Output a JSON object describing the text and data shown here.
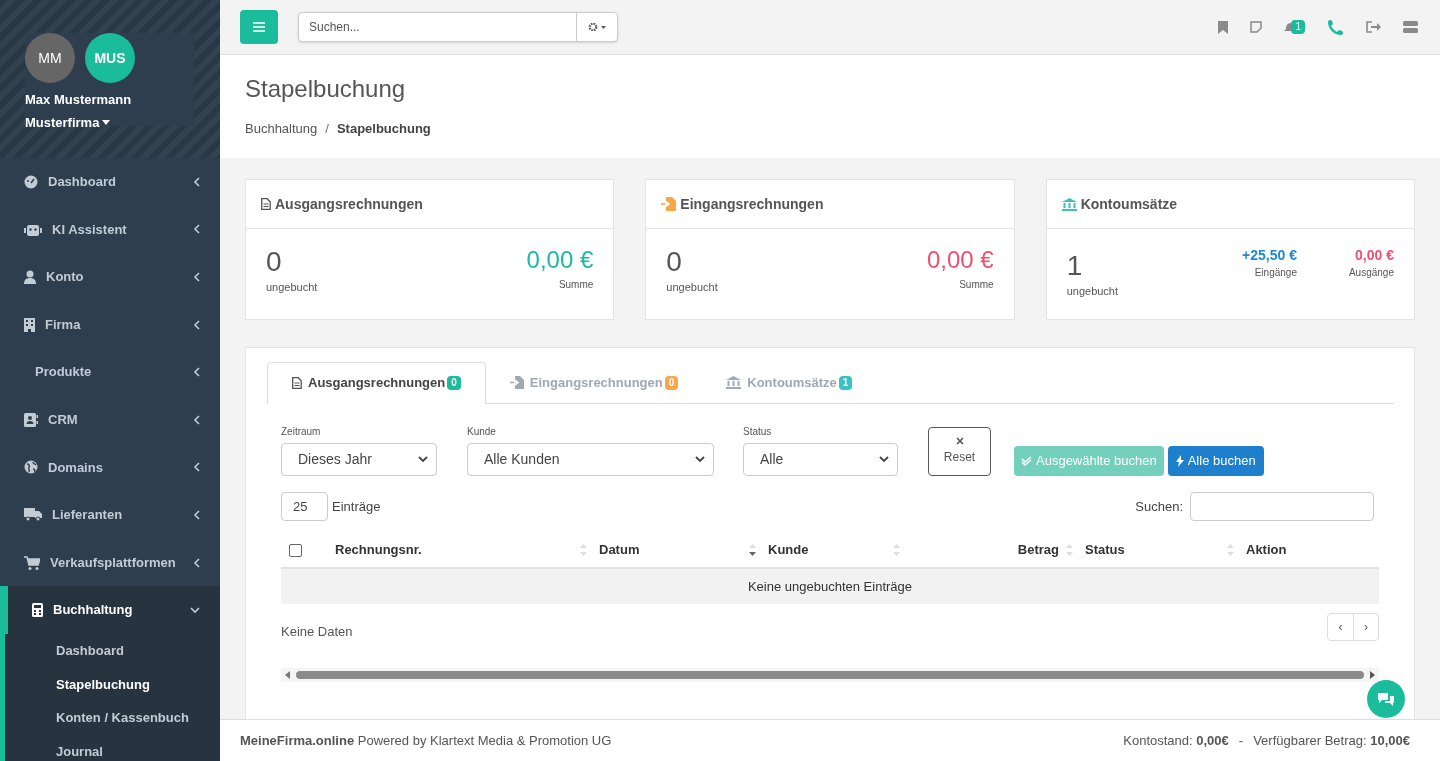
{
  "profile": {
    "avatars": [
      "MM",
      "MUS"
    ],
    "name": "Max Mustermann",
    "company": "Musterfirma"
  },
  "sidebar": {
    "items": [
      {
        "label": "Dashboard",
        "expanded": false,
        "selected": false
      },
      {
        "label": "KI Assistent",
        "expanded": false,
        "selected": false
      },
      {
        "label": "Konto",
        "expanded": false,
        "selected": false
      },
      {
        "label": "Firma",
        "expanded": false,
        "selected": false
      },
      {
        "label": "Produkte",
        "expanded": false,
        "selected": false
      },
      {
        "label": "CRM",
        "expanded": false,
        "selected": false
      },
      {
        "label": "Domains",
        "expanded": false,
        "selected": false
      },
      {
        "label": "Lieferanten",
        "expanded": false,
        "selected": false
      },
      {
        "label": "Verkaufsplattformen",
        "expanded": false,
        "selected": false
      },
      {
        "label": "Buchhaltung",
        "expanded": true,
        "selected": true,
        "children": [
          {
            "label": "Dashboard",
            "selected": false
          },
          {
            "label": "Stapelbuchung",
            "selected": true
          },
          {
            "label": "Konten / Kassenbuch",
            "selected": false
          },
          {
            "label": "Journal",
            "selected": false
          }
        ]
      }
    ]
  },
  "topbar": {
    "search": {
      "placeholder": "Suchen..."
    },
    "notification_count": "1"
  },
  "page": {
    "title": "Stapelbuchung",
    "breadcrumb": [
      "Buchhaltung",
      "Stapelbuchung"
    ],
    "breadcrumb_separator": "/"
  },
  "cards": [
    {
      "title": "Ausgangsrechnungen",
      "count": "0",
      "count_label": "ungebucht",
      "amounts": [
        {
          "value": "0,00 €",
          "label": "Summe",
          "color": "#1abc9c"
        }
      ]
    },
    {
      "title": "Eingangsrechnungen",
      "count": "0",
      "count_label": "ungebucht",
      "amounts": [
        {
          "value": "0,00 €",
          "label": "Summe",
          "color": "#f0506e"
        }
      ]
    },
    {
      "title": "Kontoumsätze",
      "count": "1",
      "count_label": "ungebucht",
      "amounts": [
        {
          "value": "+25,50 €",
          "label": "Eingänge",
          "color": "#1e88d0"
        },
        {
          "value": "0,00 €",
          "label": "Ausgänge",
          "color": "#f0506e"
        }
      ]
    }
  ],
  "tabs": [
    {
      "label": "Ausgangsrechnungen",
      "count": "0",
      "color": "#1abc9c",
      "selected": true
    },
    {
      "label": "Eingangsrechnungen",
      "count": "0",
      "color": "#f7a64a",
      "selected": false
    },
    {
      "label": "Kontoumsätze",
      "count": "1",
      "color": "#3bc0c3",
      "selected": false
    }
  ],
  "filters": [
    {
      "label": "Zeitraum",
      "value": "Dieses Jahr"
    },
    {
      "label": "Kunde",
      "value": "Alle Kunden"
    },
    {
      "label": "Status",
      "value": "Alle"
    }
  ],
  "buttons": {
    "reset": "Reset",
    "book_selected": {
      "label": "Ausgewählte buchen",
      "disabled": true
    },
    "book_all": "Alle buchen"
  },
  "table": {
    "page_size": "25",
    "page_size_label": "Einträge",
    "search_label": "Suchen:",
    "select_all_checked": false,
    "columns": [
      {
        "label": "Rechnungsnr.",
        "sortable": true,
        "sorted_desc": false
      },
      {
        "label": "Datum",
        "sortable": true,
        "sorted_desc": true
      },
      {
        "label": "Kunde",
        "sortable": true,
        "sorted_desc": false
      },
      {
        "label": "Betrag",
        "sortable": true,
        "sorted_desc": false
      },
      {
        "label": "Status",
        "sortable": true,
        "sorted_desc": false
      },
      {
        "label": "Aktion",
        "sortable": false
      }
    ],
    "empty_message": "Keine ungebuchten Einträge",
    "info": "Keine Daten",
    "pagination": [
      "‹",
      "›"
    ]
  },
  "footer": {
    "brand": "MeineFirma.online",
    "powered": "Powered by Klartext Media & Promotion UG",
    "balance_label": "Kontostand:",
    "balance": "0,00€",
    "separator": "-",
    "available_label": "Verfügbarer Betrag:",
    "available": "10,00€"
  }
}
